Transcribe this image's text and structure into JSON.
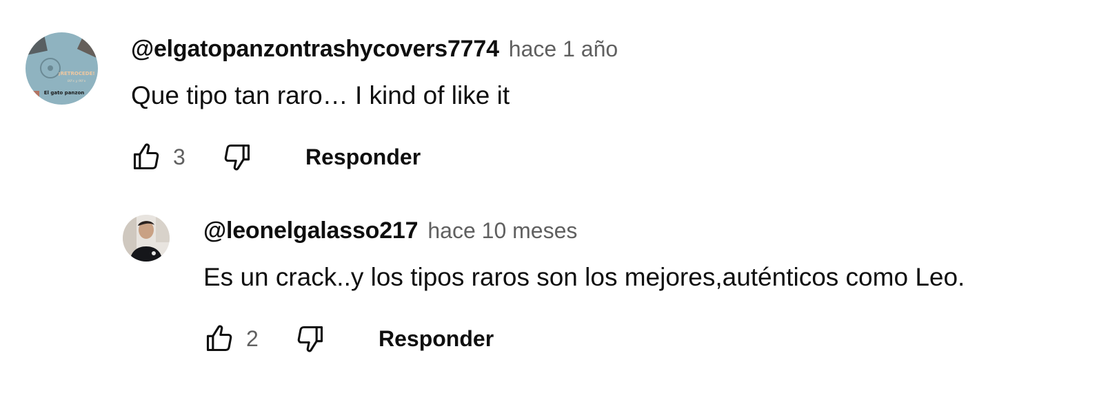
{
  "comments": [
    {
      "author": "@elgatopanzontrashycovers7774",
      "time": "hace 1 año",
      "text": "Que tipo tan raro… I kind of like it",
      "likes": "3",
      "reply_label": "Responder",
      "avatar_text": {
        "line1": "¡RETROCEDE!",
        "line2": "80's y 90's",
        "line3": "El gato panzon"
      }
    },
    {
      "author": "@leonelgalasso217",
      "time": "hace 10 meses",
      "text": "Es un crack..y los tipos raros son los mejores,auténticos como Leo.",
      "likes": "2",
      "reply_label": "Responder"
    }
  ],
  "icons": {
    "like": "thumbs-up-icon",
    "dislike": "thumbs-down-icon"
  },
  "colors": {
    "text_primary": "#0f0f0f",
    "text_secondary": "#606060",
    "avatar1_bg": "#8fb3c0"
  }
}
